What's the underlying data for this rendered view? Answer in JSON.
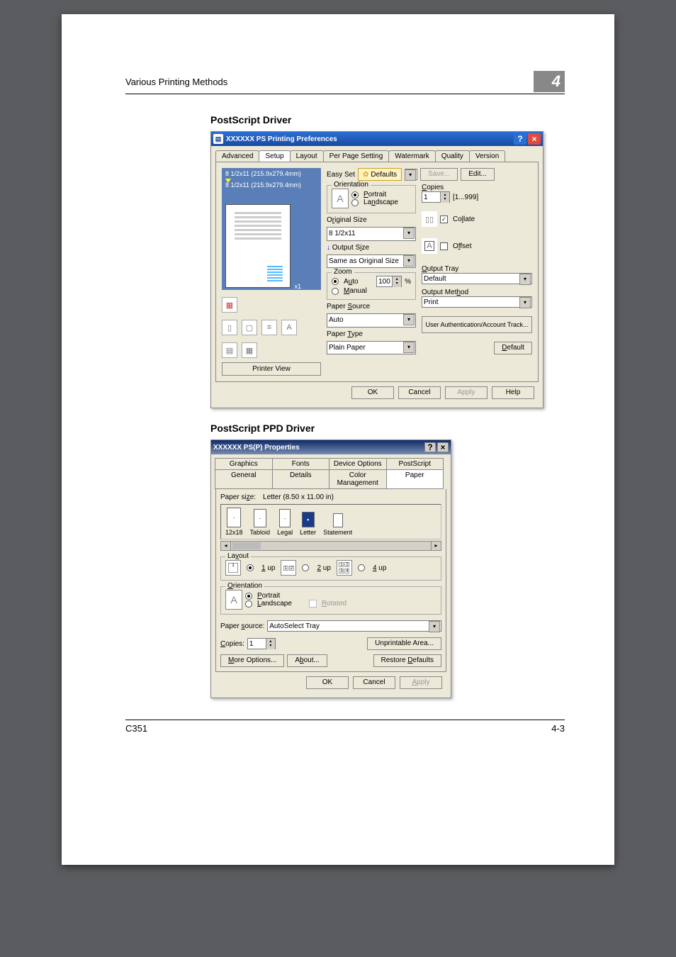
{
  "running_head": "Various Printing Methods",
  "chapter_number": "4",
  "section1_title": "PostScript Driver",
  "section2_title": "PostScript PPD Driver",
  "footer_left": "C351",
  "footer_right": "4-3",
  "d1": {
    "title": "XXXXXX PS Printing Preferences",
    "tabs": [
      "Advanced",
      "Setup",
      "Layout",
      "Per Page Setting",
      "Watermark",
      "Quality",
      "Version"
    ],
    "active_tab": "Setup",
    "preview_line1": "8 1/2x11 (215.9x279.4mm)",
    "preview_line2": "8 1/2x11 (215.9x279.4mm)",
    "preview_zoom": "x1",
    "printer_view": "Printer View",
    "easy_set_label": "Easy Set",
    "defaults_btn": "Defaults",
    "save_btn": "Save...",
    "edit_btn": "Edit...",
    "orientation_legend": "Orientation",
    "portrait": "Portrait",
    "landscape": "Landscape",
    "original_size_label": "Original Size",
    "original_size_value": "8 1/2x11",
    "output_size_label": "Output Size",
    "output_size_value": "Same as Original Size",
    "zoom_legend": "Zoom",
    "zoom_auto": "Auto",
    "zoom_manual": "Manual",
    "zoom_value": "100",
    "zoom_pct": "%",
    "paper_source_label": "Paper Source",
    "paper_source_value": "Auto",
    "paper_type_label": "Paper Type",
    "paper_type_value": "Plain Paper",
    "copies_label": "Copies",
    "copies_value": "1",
    "copies_range": "[1...999]",
    "collate": "Collate",
    "offset": "Offset",
    "output_tray_label": "Output Tray",
    "output_tray_value": "Default",
    "output_method_label": "Output Method",
    "output_method_value": "Print",
    "user_auth_btn": "User Authentication/Account Track...",
    "default_btn": "Default",
    "ok": "OK",
    "cancel": "Cancel",
    "apply": "Apply",
    "help": "Help"
  },
  "d2": {
    "title": "XXXXXX PS(P) Properties",
    "tabs_row1": [
      "Graphics",
      "Fonts",
      "Device Options",
      "PostScript"
    ],
    "tabs_row2": [
      "General",
      "Details",
      "Color Management",
      "Paper"
    ],
    "active_tab": "Paper",
    "paper_size_label": "Paper size:",
    "paper_size_value": "Letter (8.50 x 11.00 in)",
    "sizes": [
      "12x18",
      "Tabloid",
      "Legal",
      "Letter",
      "Statement"
    ],
    "selected_size": "Letter",
    "layout_legend": "Layout",
    "nup_1": "1 up",
    "nup_2": "2 up",
    "nup_4": "4 up",
    "orientation_legend": "Orientation",
    "portrait": "Portrait",
    "landscape": "Landscape",
    "rotated": "Rotated",
    "paper_source_label": "Paper source:",
    "paper_source_value": "AutoSelect Tray",
    "copies_label": "Copies:",
    "copies_value": "1",
    "unprintable": "Unprintable Area...",
    "more_options": "More Options...",
    "about": "About...",
    "restore": "Restore Defaults",
    "ok": "OK",
    "cancel": "Cancel",
    "apply": "Apply"
  }
}
